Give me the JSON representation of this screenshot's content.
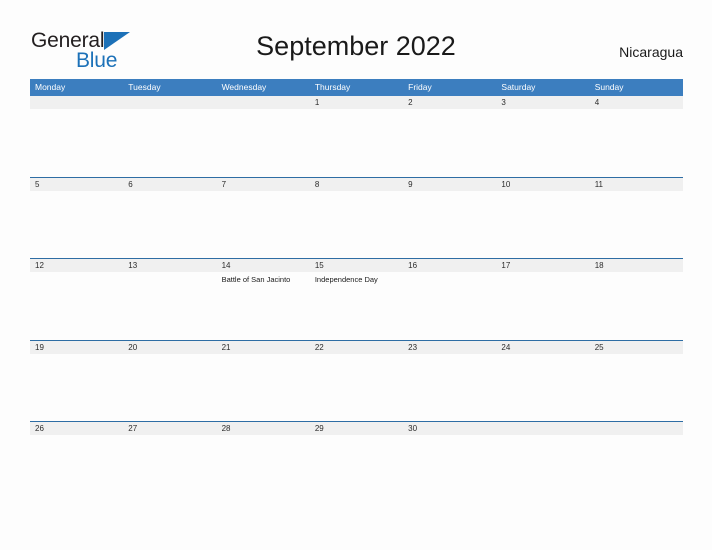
{
  "brand": {
    "name_part1": "General",
    "name_part2": "Blue",
    "logo_icon": "triangle-flag-icon",
    "colors": {
      "blue": "#1c71b8",
      "dark": "#231f20"
    }
  },
  "header": {
    "title": "September 2022",
    "country": "Nicaragua"
  },
  "calendar": {
    "colors": {
      "header_bar": "#3c7ebf",
      "row_band": "#f0f0f0",
      "row_border": "#2e6da4",
      "page_background": "#fdfdfd"
    },
    "weekdays": [
      "Monday",
      "Tuesday",
      "Wednesday",
      "Thursday",
      "Friday",
      "Saturday",
      "Sunday"
    ],
    "weeks": [
      [
        {
          "day": "",
          "events": []
        },
        {
          "day": "",
          "events": []
        },
        {
          "day": "",
          "events": []
        },
        {
          "day": "1",
          "events": []
        },
        {
          "day": "2",
          "events": []
        },
        {
          "day": "3",
          "events": []
        },
        {
          "day": "4",
          "events": []
        }
      ],
      [
        {
          "day": "5",
          "events": []
        },
        {
          "day": "6",
          "events": []
        },
        {
          "day": "7",
          "events": []
        },
        {
          "day": "8",
          "events": []
        },
        {
          "day": "9",
          "events": []
        },
        {
          "day": "10",
          "events": []
        },
        {
          "day": "11",
          "events": []
        }
      ],
      [
        {
          "day": "12",
          "events": []
        },
        {
          "day": "13",
          "events": []
        },
        {
          "day": "14",
          "events": [
            "Battle of San Jacinto"
          ]
        },
        {
          "day": "15",
          "events": [
            "Independence Day"
          ]
        },
        {
          "day": "16",
          "events": []
        },
        {
          "day": "17",
          "events": []
        },
        {
          "day": "18",
          "events": []
        }
      ],
      [
        {
          "day": "19",
          "events": []
        },
        {
          "day": "20",
          "events": []
        },
        {
          "day": "21",
          "events": []
        },
        {
          "day": "22",
          "events": []
        },
        {
          "day": "23",
          "events": []
        },
        {
          "day": "24",
          "events": []
        },
        {
          "day": "25",
          "events": []
        }
      ],
      [
        {
          "day": "26",
          "events": []
        },
        {
          "day": "27",
          "events": []
        },
        {
          "day": "28",
          "events": []
        },
        {
          "day": "29",
          "events": []
        },
        {
          "day": "30",
          "events": []
        },
        {
          "day": "",
          "events": []
        },
        {
          "day": "",
          "events": []
        }
      ]
    ]
  }
}
